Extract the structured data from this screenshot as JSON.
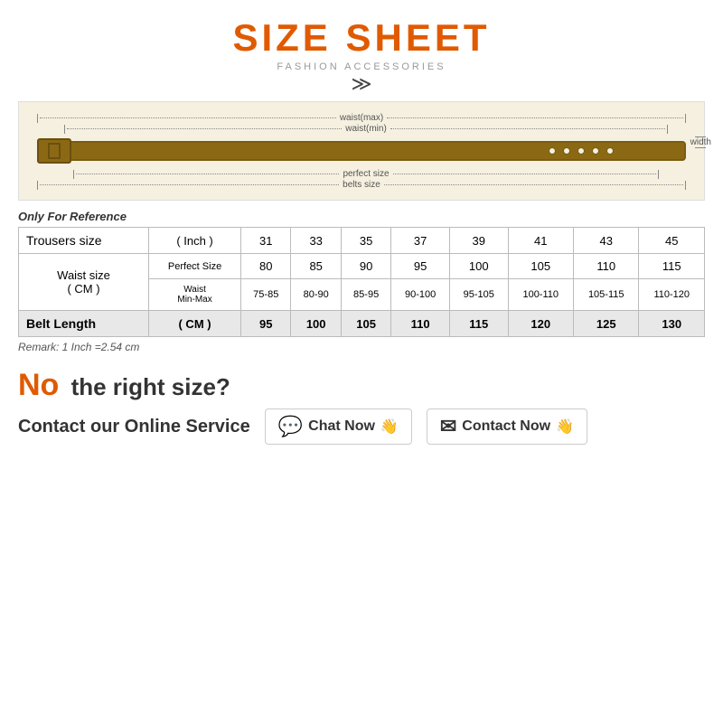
{
  "header": {
    "title": "SIZE SHEET",
    "subtitle": "FASHION ACCESSORIES",
    "chevrons": "❯❯"
  },
  "belt_diagram": {
    "waist_max_label": "waist(max)",
    "waist_min_label": "waist(min)",
    "perfect_size_label": "perfect size",
    "belts_size_label": "belts size",
    "width_label": "width"
  },
  "reference_text": "Only For Reference",
  "table": {
    "col_trousers": "Trousers size",
    "col_inch": "( Inch )",
    "col_sizes": [
      "31",
      "33",
      "35",
      "37",
      "39",
      "41",
      "43",
      "45"
    ],
    "waist_size_label": "Waist size",
    "waist_size_unit": "( CM )",
    "perfect_size_label": "Perfect Size",
    "waist_min_max_label": "Waist Min-Max",
    "perfect_sizes": [
      "80",
      "85",
      "90",
      "95",
      "100",
      "105",
      "110",
      "115"
    ],
    "min_max_sizes": [
      "75-85",
      "80-90",
      "85-95",
      "90-100",
      "95-105",
      "100-110",
      "105-115",
      "110-120"
    ],
    "belt_length_label": "Belt Length",
    "belt_length_unit": "( CM )",
    "belt_lengths": [
      "95",
      "100",
      "105",
      "110",
      "115",
      "120",
      "125",
      "130"
    ]
  },
  "remark": "Remark: 1 Inch =2.54 cm",
  "bottom": {
    "no_text": "No",
    "no_size_question": "the right size?",
    "contact_label": "Contact our Online Service",
    "chat_btn": "Chat Now",
    "contact_btn": "Contact Now",
    "chat_icon": "💬",
    "contact_icon": "✉",
    "hand_icon": "👋"
  }
}
